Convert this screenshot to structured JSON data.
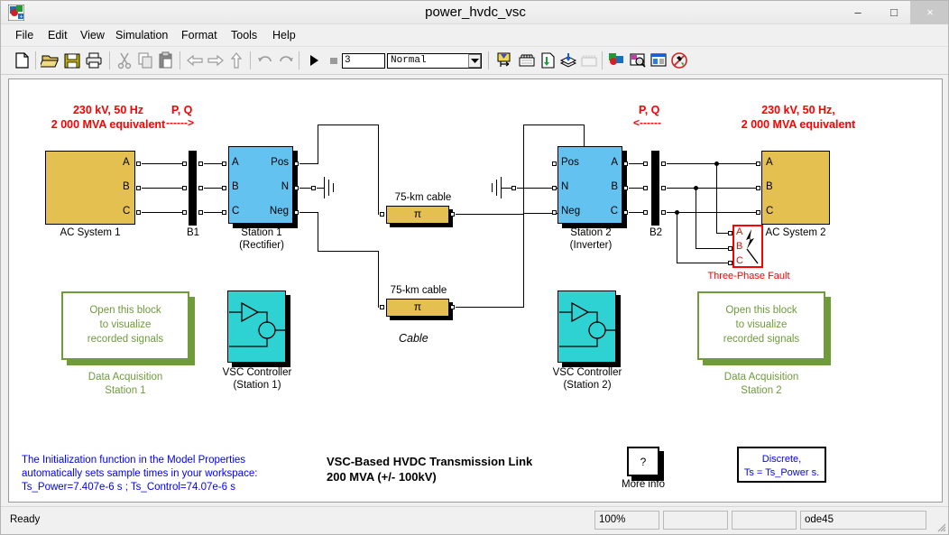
{
  "window": {
    "title": "power_hvdc_vsc",
    "icon": "simulink-icon",
    "minimize": "–",
    "maximize": "□",
    "close": "×"
  },
  "menubar": {
    "items": [
      {
        "label": "File"
      },
      {
        "label": "Edit"
      },
      {
        "label": "View"
      },
      {
        "label": "Simulation"
      },
      {
        "label": "Format"
      },
      {
        "label": "Tools"
      },
      {
        "label": "Help"
      }
    ]
  },
  "toolbar": {
    "sim_time": "3",
    "sim_mode": "Normal",
    "sim_mode_arrow": "▼",
    "icons": [
      "new-model-icon",
      "open-model-icon",
      "save-icon",
      "print-icon",
      "cut-icon",
      "copy-icon",
      "paste-icon",
      "back-icon",
      "forward-icon",
      "up-icon",
      "undo-icon",
      "redo-icon",
      "start-simulation-icon",
      "stop-simulation-icon",
      "library-browser-icon",
      "model-explorer-icon",
      "update-diagram-icon",
      "build-model-icon",
      "debug-icon",
      "simulink-model-icon",
      "find-icon",
      "block-parameters-icon",
      "disable-links-icon"
    ]
  },
  "canvas": {
    "annotations": {
      "left_source": "230 kV, 50 Hz\n2 000 MVA equivalent",
      "left_pq": "P, Q",
      "left_pq_arrow": "------>",
      "right_pq": "P, Q",
      "right_pq_arrow": "<------",
      "right_source": "230 kV, 50 Hz,\n2 000 MVA equivalent",
      "cable_label": "Cable",
      "title": "VSC-Based HVDC Transmission Link\n200 MVA  (+/- 100kV)",
      "init_note": "The  Initialization function in the Model Properties\nautomatically sets sample times in your workspace:\nTs_Power=7.407e-6 s ; Ts_Control=74.07e-6 s"
    },
    "blocks": {
      "ac_system_1": {
        "caption": "AC System 1",
        "ports": [
          "A",
          "B",
          "C"
        ],
        "color": "#e3c04f"
      },
      "busbar_1": {
        "caption": "B1"
      },
      "station_1": {
        "caption": "Station 1\n(Rectifier)",
        "ports_in": [
          "A",
          "B",
          "C"
        ],
        "ports_out": [
          "Pos",
          "N",
          "Neg"
        ],
        "color": "#64c2f0"
      },
      "cable_top": {
        "label": "75-km cable",
        "symbol": "π"
      },
      "cable_bottom": {
        "label": "75-km cable",
        "symbol": "π"
      },
      "station_2": {
        "caption": "Station 2\n(Inverter)",
        "ports_in": [
          "Pos",
          "N",
          "Neg"
        ],
        "ports_out": [
          "A",
          "B",
          "C"
        ],
        "color": "#64c2f0"
      },
      "busbar_2": {
        "caption": "B2"
      },
      "ac_system_2": {
        "caption": "AC System 2",
        "ports": [
          "A",
          "B",
          "C"
        ],
        "color": "#e3c04f"
      },
      "three_phase_fault": {
        "caption": "Three-Phase Fault",
        "ports": [
          "A",
          "B",
          "C"
        ],
        "color": "#ff0000"
      },
      "daq_1": {
        "text": "Open this block\nto visualize\nrecorded signals",
        "caption": "Data Acquisition\nStation 1",
        "color": "#6f9b3a"
      },
      "daq_2": {
        "text": "Open this block\nto visualize\nrecorded signals",
        "caption": "Data Acquisition\nStation 2",
        "color": "#6f9b3a"
      },
      "vsc_controller_1": {
        "caption": "VSC Controller\n(Station 1)",
        "color": "#2fd2d2"
      },
      "vsc_controller_2": {
        "caption": "VSC Controller\n(Station 2)",
        "color": "#2fd2d2"
      },
      "more_info": {
        "symbol": "?",
        "caption": "More info"
      },
      "powergui": {
        "text": "Discrete,\nTs = Ts_Power s."
      }
    }
  },
  "statusbar": {
    "status": "Ready",
    "zoom": "100%",
    "panel2": "",
    "panel3": "",
    "solver": "ode45"
  }
}
